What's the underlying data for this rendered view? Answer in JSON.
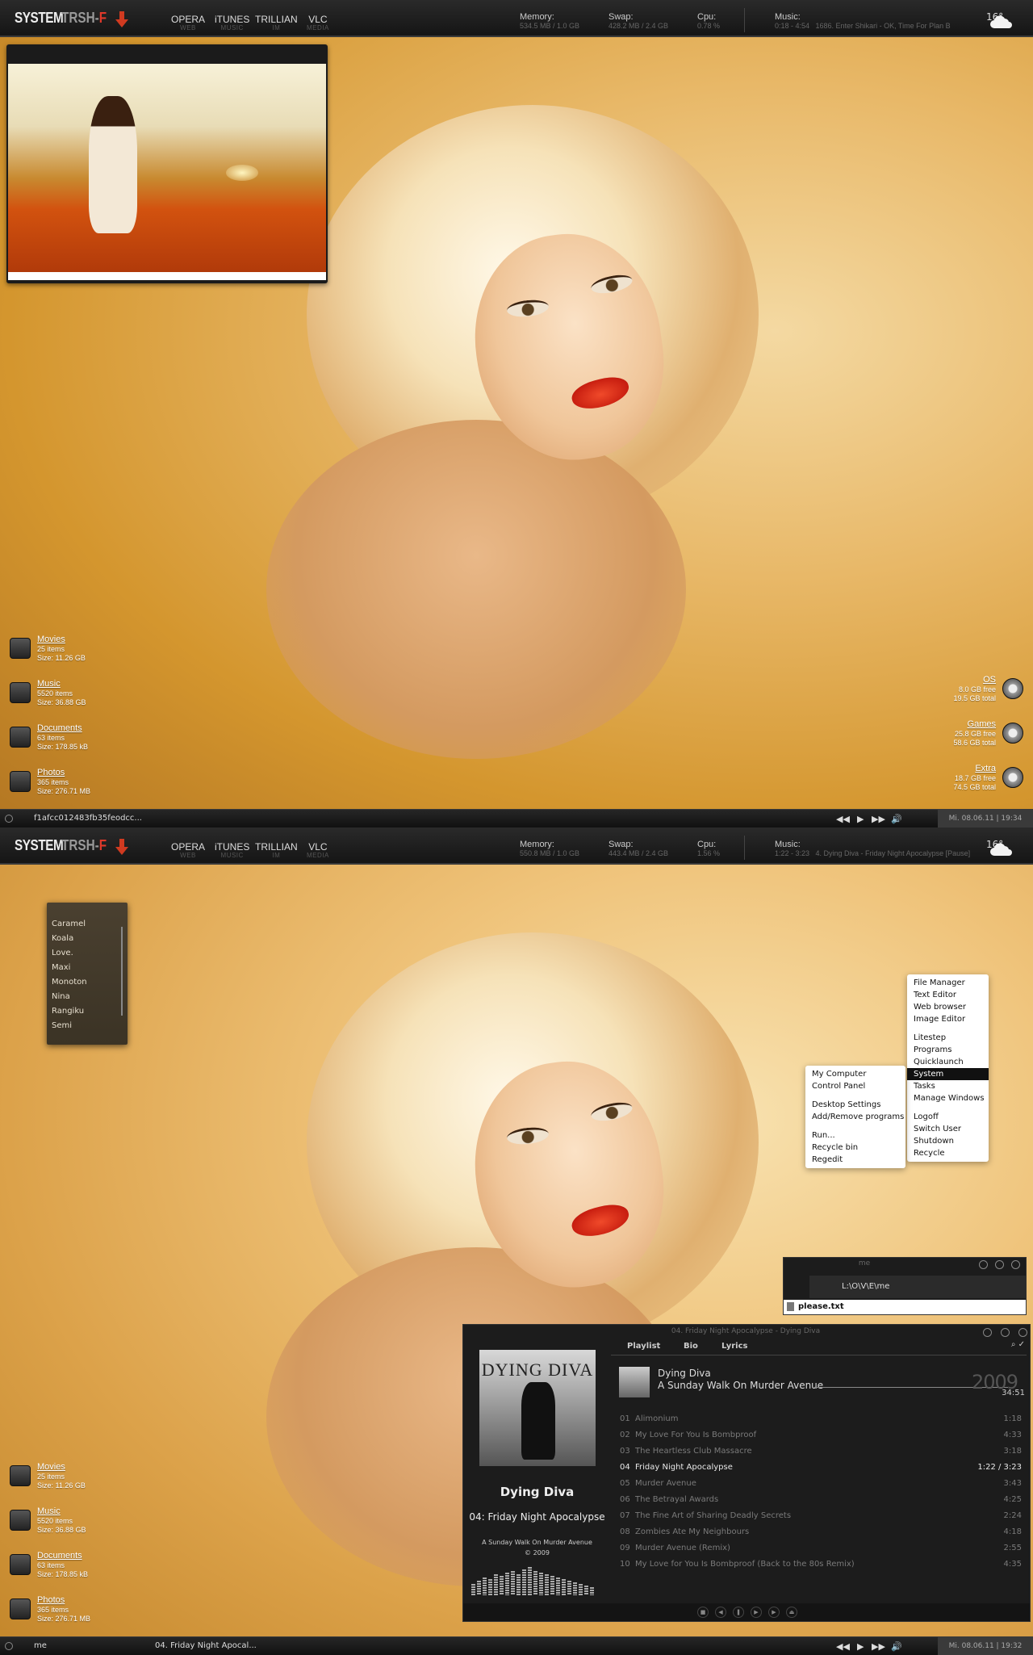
{
  "topbar1": {
    "logo": "SYSTEM",
    "logo_trsh": "TRSH-",
    "logo_f": "F",
    "launchers": [
      {
        "name": "OPERA",
        "sub": "WEB"
      },
      {
        "name": "iTUNES",
        "sub": "MUSIC"
      },
      {
        "name": "TRILLIAN",
        "sub": "IM"
      },
      {
        "name": "VLC",
        "sub": "MEDIA"
      }
    ],
    "memory_label": "Memory:",
    "memory_value": "534.5 MB / 1.0 GB",
    "swap_label": "Swap:",
    "swap_value": "428.2 MB / 2.4 GB",
    "cpu_label": "Cpu:",
    "cpu_value": "0.78 %",
    "music_label": "Music:",
    "music_value": "0:18 - 4:54   1686. Enter Shikari - OK, Time For Plan B",
    "temperature": "16°"
  },
  "topbar2": {
    "logo": "SYSTEM",
    "logo_trsh": "TRSH-",
    "logo_f": "F",
    "launchers": [
      {
        "name": "OPERA",
        "sub": "WEB"
      },
      {
        "name": "iTUNES",
        "sub": "MUSIC"
      },
      {
        "name": "TRILLIAN",
        "sub": "IM"
      },
      {
        "name": "VLC",
        "sub": "MEDIA"
      }
    ],
    "memory_label": "Memory:",
    "memory_value": "550.8 MB / 1.0 GB",
    "swap_label": "Swap:",
    "swap_value": "443.4 MB / 2.4 GB",
    "cpu_label": "Cpu:",
    "cpu_value": "1.56 %",
    "music_label": "Music:",
    "music_value": "1:22 - 3:23   4. Dying Diva - Friday Night Apocalypse [Pause]",
    "temperature": "16°"
  },
  "folders": [
    {
      "name": "Movies",
      "items": "25 items",
      "size": "Size: 11.26 GB"
    },
    {
      "name": "Music",
      "items": "5520 items",
      "size": "Size: 36.88 GB"
    },
    {
      "name": "Documents",
      "items": "63 items",
      "size": "Size: 178.85 kB"
    },
    {
      "name": "Photos",
      "items": "365 items",
      "size": "Size: 276.71 MB"
    }
  ],
  "drives": [
    {
      "name": "OS",
      "free": "8.0 GB free",
      "total": "19.5 GB total"
    },
    {
      "name": "Games",
      "free": "25.8 GB free",
      "total": "58.6 GB total"
    },
    {
      "name": "Extra",
      "free": "18.7 GB free",
      "total": "74.5 GB total"
    }
  ],
  "taskbar1": {
    "task": "f1afcc012483fb35feodcc...",
    "clock": "Mi. 08.06.11 | 19:34"
  },
  "taskbar2": {
    "task1": "me",
    "task2": "04. Friday Night Apocal...",
    "clock": "Mi. 08.06.11 | 19:32"
  },
  "media_controls": {
    "prev": "◀◀",
    "play": "▶",
    "next": "▶▶",
    "volume": "🔊"
  },
  "themes": [
    "Caramel",
    "Koala",
    "Love.",
    "Maxi",
    "Monoton",
    "Nina",
    "Rangiku",
    "Semi"
  ],
  "main_menu": {
    "group1": [
      "File Manager",
      "Text Editor",
      "Web browser",
      "Image Editor"
    ],
    "group2": [
      "Litestep",
      "Programs",
      "Quicklaunch",
      "System",
      "Tasks",
      "Manage Windows"
    ],
    "group3": [
      "Logoff",
      "Switch User",
      "Shutdown",
      "Recycle"
    ],
    "selected": "System"
  },
  "system_menu": {
    "group1": [
      "My Computer",
      "Control Panel"
    ],
    "group2": [
      "Desktop Settings",
      "Add/Remove programs"
    ],
    "group3": [
      "Run...",
      "Recycle bin",
      "Regedit"
    ]
  },
  "explorer": {
    "title": "me",
    "path": "L:\\O\\V\\E\\me",
    "file": "please.txt"
  },
  "player": {
    "title": "04. Friday Night Apocalypse - Dying Diva",
    "tabs": [
      "Playlist",
      "Bio",
      "Lyrics"
    ],
    "tools": "⌕ ✓",
    "cover_text": "DYING DIVA",
    "artist": "Dying Diva",
    "now_playing": "04: Friday Night Apocalypse",
    "album": "A Sunday Walk On Murder Avenue",
    "copyright": "© 2009",
    "pl_artist": "Dying Diva",
    "pl_album": "A Sunday Walk On Murder Avenue",
    "pl_year": "2009",
    "pl_total": "34:51",
    "tracks": [
      {
        "no": "01",
        "title": "Alimonium",
        "dur": "1:18"
      },
      {
        "no": "02",
        "title": "My Love For You Is Bombproof",
        "dur": "4:33"
      },
      {
        "no": "03",
        "title": "The Heartless Club Massacre",
        "dur": "3:18"
      },
      {
        "no": "04",
        "title": "Friday Night Apocalypse",
        "dur": "1:22 / 3:23"
      },
      {
        "no": "05",
        "title": "Murder Avenue",
        "dur": "3:43"
      },
      {
        "no": "06",
        "title": "The Betrayal Awards",
        "dur": "4:25"
      },
      {
        "no": "07",
        "title": "The Fine Art of Sharing Deadly Secrets",
        "dur": "2:24"
      },
      {
        "no": "08",
        "title": "Zombies Ate My Neighbours",
        "dur": "4:18"
      },
      {
        "no": "09",
        "title": "Murder Avenue (Remix)",
        "dur": "2:55"
      },
      {
        "no": "10",
        "title": "My Love for You Is Bombproof (Back to the 80s Remix)",
        "dur": "4:35"
      }
    ],
    "current_track": "04"
  }
}
